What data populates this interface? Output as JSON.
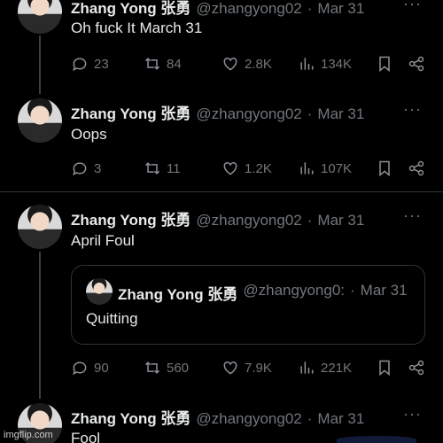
{
  "tweets": [
    {
      "name": "Zhang Yong 张勇",
      "handle": "@zhangyong02",
      "time": "Mar 31",
      "text": "Oh fuck It March 31",
      "replies": "23",
      "retweets": "84",
      "likes": "2.8K",
      "views": "134K"
    },
    {
      "name": "Zhang Yong 张勇",
      "handle": "@zhangyong02",
      "time": "Mar 31",
      "text": "Oops",
      "replies": "3",
      "retweets": "11",
      "likes": "1.2K",
      "views": "107K"
    },
    {
      "name": "Zhang Yong 张勇",
      "handle": "@zhangyong02",
      "time": "Mar 31",
      "text": "April Foul",
      "replies": "90",
      "retweets": "560",
      "likes": "7.9K",
      "views": "221K",
      "quote": {
        "name": "Zhang Yong 张勇",
        "handle": "@zhangyong0:",
        "time": "Mar 31",
        "text": "Quitting"
      }
    },
    {
      "name": "Zhang Yong 张勇",
      "handle": "@zhangyong02",
      "time": "Mar 31",
      "text": "Fool"
    }
  ],
  "more_label": "···",
  "separator": "·",
  "watermark": "imgflip.com",
  "icons": [
    "reply-icon",
    "retweet-icon",
    "like-icon",
    "views-icon",
    "bookmark-icon",
    "share-icon",
    "more-icon"
  ]
}
